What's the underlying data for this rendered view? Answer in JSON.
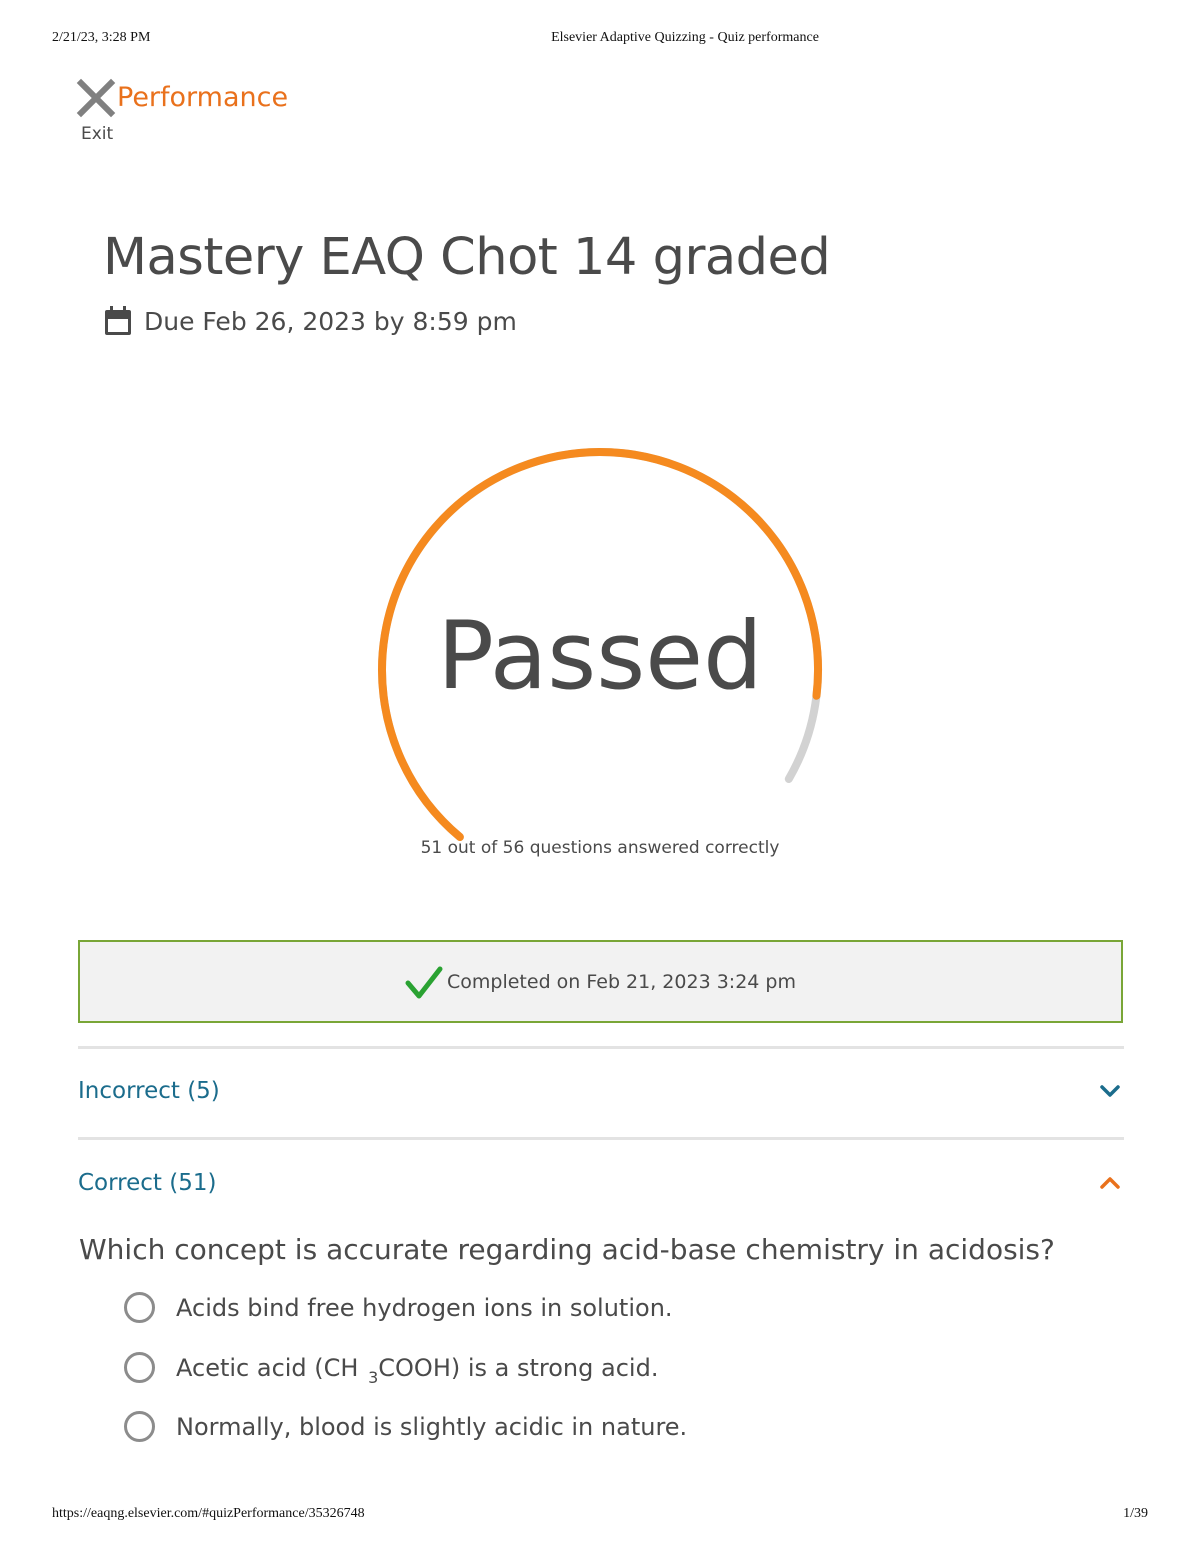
{
  "print_header": {
    "datetime": "2/21/23, 3:28 PM",
    "page_title": "Elsevier Adaptive Quizzing - Quiz performance"
  },
  "print_footer": {
    "url": "https://eaqng.elsevier.com/#quizPerformance/35326748",
    "page_number": "1/39"
  },
  "header": {
    "title": "Performance",
    "exit_label": "Exit",
    "exit_icon": "close-x-icon"
  },
  "quiz": {
    "title": "Mastery EAQ Chot 14 graded",
    "due_icon": "calendar-icon",
    "due": "Due Feb 26, 2023 by 8:59 pm"
  },
  "score": {
    "status": "Passed",
    "correct": 51,
    "total": 56,
    "caption": "51 out of 56 questions answered correctly",
    "fraction_correct": 0.9107
  },
  "completion": {
    "icon": "checkmark-icon",
    "text": "Completed on Feb 21, 2023 3:24 pm"
  },
  "sections": {
    "incorrect": {
      "label": "Incorrect (5)",
      "icon": "chevron-down-icon"
    },
    "correct": {
      "label": "Correct (51)",
      "icon": "chevron-up-icon"
    }
  },
  "question": {
    "text": "Which concept is accurate regarding acid-base chemistry in acidosis?",
    "options": [
      {
        "text": "Acids bind free hydrogen ions in solution."
      },
      {
        "before": "Acetic acid (CH ",
        "subscript": "3",
        "after": "COOH) is a strong acid."
      },
      {
        "text": "Normally, blood is slightly acidic in nature."
      }
    ]
  },
  "colors": {
    "accent_orange": "#f58a1f",
    "title_orange": "#e9711c",
    "track_gray": "#d2d2d2",
    "link_blue": "#1b6c8c",
    "success_green": "#79a637",
    "check_green": "#2aa232"
  }
}
